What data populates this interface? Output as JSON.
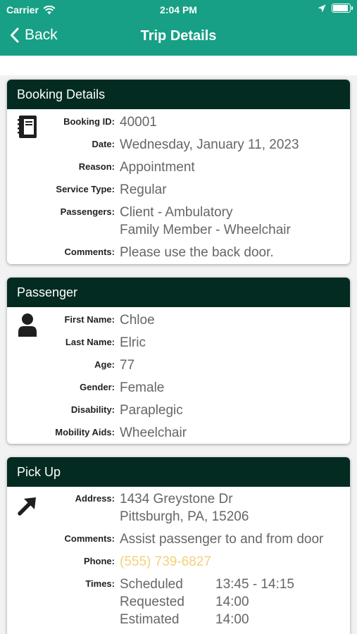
{
  "status_bar": {
    "carrier": "Carrier",
    "time": "2:04 PM",
    "battery_level": 0.92
  },
  "nav": {
    "back_label": "Back",
    "title": "Trip Details"
  },
  "booking": {
    "heading": "Booking Details",
    "booking_id_label": "Booking ID:",
    "booking_id": "40001",
    "date_label": "Date:",
    "date": "Wednesday, January 11, 2023",
    "reason_label": "Reason:",
    "reason": "Appointment",
    "service_type_label": "Service Type:",
    "service_type": "Regular",
    "passengers_label": "Passengers:",
    "passengers": [
      "Client - Ambulatory",
      "Family Member - Wheelchair"
    ],
    "comments_label": "Comments:",
    "comments": "Please use the back door."
  },
  "passenger": {
    "heading": "Passenger",
    "first_name_label": "First Name:",
    "first_name": "Chloe",
    "last_name_label": "Last Name:",
    "last_name": "Elric",
    "age_label": "Age:",
    "age": "77",
    "gender_label": "Gender:",
    "gender": "Female",
    "disability_label": "Disability:",
    "disability": "Paraplegic",
    "mobility_label": "Mobility Aids:",
    "mobility": "Wheelchair"
  },
  "pickup": {
    "heading": "Pick Up",
    "address_label": "Address:",
    "address_line1": "1434 Greystone Dr",
    "address_line2": "Pittsburgh, PA, 15206",
    "comments_label": "Comments:",
    "comments": "Assist passenger to and from door",
    "phone_label": "Phone:",
    "phone": "(555) 739-6827",
    "times_label": "Times:",
    "times": [
      {
        "name": "Scheduled",
        "value": "13:45 - 14:15"
      },
      {
        "name": "Requested",
        "value": "14:00"
      },
      {
        "name": "Estimated",
        "value": "14:00"
      }
    ]
  },
  "colors": {
    "header": "#17a085",
    "card_header": "#032b21",
    "phone": "#f3d27a"
  },
  "icons": {
    "booking": "notebook-icon",
    "passenger": "person-icon",
    "pickup": "arrow-up-right-icon"
  }
}
